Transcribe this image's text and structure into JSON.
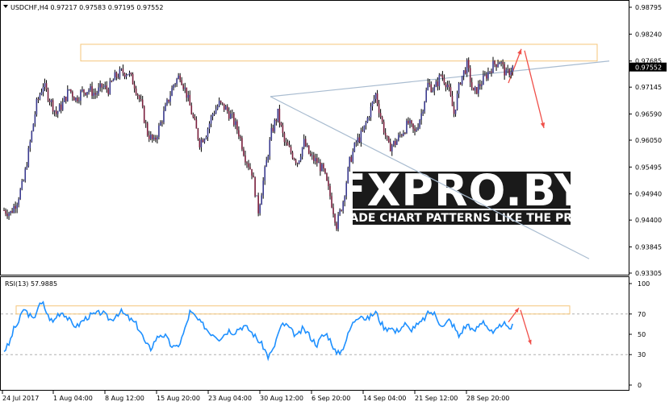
{
  "chart_data": [
    {
      "type": "candlestick",
      "symbol_timeframe": "USDCHF,H4",
      "ohlc_header": "0.97217 0.97583 0.97195 0.97552",
      "current_price_label": "0.97552",
      "y_ticks": [
        "0.98795",
        "0.98240",
        "0.97685",
        "0.97145",
        "0.96590",
        "0.96050",
        "0.95495",
        "0.94940",
        "0.94400",
        "0.93845",
        "0.93305"
      ],
      "ylim": [
        0.93305,
        0.98795
      ],
      "x_ticks": [
        "24 Jul 2017",
        "1 Aug 04:00",
        "8 Aug 12:00",
        "15 Aug 20:00",
        "23 Aug 04:00",
        "30 Aug 12:00",
        "6 Sep 20:00",
        "14 Sep 04:00",
        "21 Sep 12:00",
        "28 Sep 20:00"
      ],
      "close_anchors": [
        [
          0,
          0.946
        ],
        [
          4,
          0.9455
        ],
        [
          8,
          0.948
        ],
        [
          12,
          0.952
        ],
        [
          16,
          0.96
        ],
        [
          20,
          0.968
        ],
        [
          24,
          0.972
        ],
        [
          28,
          0.969
        ],
        [
          32,
          0.966
        ],
        [
          36,
          0.968
        ],
        [
          40,
          0.971
        ],
        [
          44,
          0.969
        ],
        [
          48,
          0.9705
        ],
        [
          52,
          0.971
        ],
        [
          56,
          0.97
        ],
        [
          60,
          0.9715
        ],
        [
          64,
          0.971
        ],
        [
          68,
          0.9735
        ],
        [
          72,
          0.9745
        ],
        [
          76,
          0.9745
        ],
        [
          80,
          0.972
        ],
        [
          84,
          0.968
        ],
        [
          88,
          0.962
        ],
        [
          92,
          0.96
        ],
        [
          96,
          0.964
        ],
        [
          100,
          0.968
        ],
        [
          104,
          0.972
        ],
        [
          108,
          0.974
        ],
        [
          112,
          0.97
        ],
        [
          116,
          0.965
        ],
        [
          120,
          0.96
        ],
        [
          124,
          0.962
        ],
        [
          128,
          0.966
        ],
        [
          132,
          0.968
        ],
        [
          136,
          0.967
        ],
        [
          140,
          0.965
        ],
        [
          144,
          0.962
        ],
        [
          148,
          0.957
        ],
        [
          152,
          0.954
        ],
        [
          156,
          0.946
        ],
        [
          160,
          0.954
        ],
        [
          164,
          0.962
        ],
        [
          168,
          0.966
        ],
        [
          172,
          0.96
        ],
        [
          176,
          0.958
        ],
        [
          180,
          0.956
        ],
        [
          184,
          0.96
        ],
        [
          188,
          0.957
        ],
        [
          192,
          0.956
        ],
        [
          196,
          0.954
        ],
        [
          200,
          0.949
        ],
        [
          204,
          0.943
        ],
        [
          208,
          0.948
        ],
        [
          212,
          0.956
        ],
        [
          216,
          0.96
        ],
        [
          220,
          0.962
        ],
        [
          224,
          0.966
        ],
        [
          228,
          0.97
        ],
        [
          232,
          0.964
        ],
        [
          236,
          0.959
        ],
        [
          240,
          0.96
        ],
        [
          244,
          0.962
        ],
        [
          248,
          0.964
        ],
        [
          252,
          0.962
        ],
        [
          256,
          0.966
        ],
        [
          260,
          0.972
        ],
        [
          264,
          0.971
        ],
        [
          268,
          0.974
        ],
        [
          272,
          0.972
        ],
        [
          276,
          0.966
        ],
        [
          280,
          0.973
        ],
        [
          284,
          0.976
        ],
        [
          288,
          0.97
        ],
        [
          292,
          0.972
        ],
        [
          296,
          0.974
        ],
        [
          300,
          0.976
        ],
        [
          304,
          0.977
        ],
        [
          308,
          0.974
        ],
        [
          312,
          0.9755
        ]
      ],
      "overlays": {
        "resistance_zone": [
          0.97685,
          0.9803
        ],
        "rising_trendline": [
          [
            0.9695
          ],
          [
            0.97685
          ]
        ],
        "falling_trendline": [
          [
            0.9695
          ],
          [
            0.936
          ]
        ],
        "projected_move": [
          0.98,
          0.963
        ]
      },
      "watermark": {
        "brand": "FXPRO.BY",
        "tagline": "TRADE CHART PATTERNS LIKE THE PROS"
      }
    },
    {
      "type": "line",
      "indicator": "RSI(13) 57.9885",
      "ylim": [
        0,
        100
      ],
      "y_ticks": [
        "100",
        "70",
        "50",
        "30",
        "0"
      ],
      "levels": [
        70,
        30
      ],
      "zone": [
        70,
        78
      ],
      "values": [
        [
          0,
          34
        ],
        [
          3,
          40
        ],
        [
          6,
          55
        ],
        [
          9,
          62
        ],
        [
          12,
          75
        ],
        [
          15,
          70
        ],
        [
          18,
          64
        ],
        [
          21,
          78
        ],
        [
          24,
          80
        ],
        [
          27,
          68
        ],
        [
          30,
          62
        ],
        [
          33,
          70
        ],
        [
          36,
          72
        ],
        [
          39,
          66
        ],
        [
          42,
          60
        ],
        [
          45,
          58
        ],
        [
          48,
          63
        ],
        [
          51,
          67
        ],
        [
          54,
          69
        ],
        [
          57,
          70
        ],
        [
          60,
          72
        ],
        [
          63,
          67
        ],
        [
          66,
          64
        ],
        [
          69,
          70
        ],
        [
          72,
          72
        ],
        [
          75,
          68
        ],
        [
          78,
          64
        ],
        [
          81,
          60
        ],
        [
          84,
          52
        ],
        [
          87,
          40
        ],
        [
          90,
          36
        ],
        [
          93,
          45
        ],
        [
          96,
          50
        ],
        [
          99,
          48
        ],
        [
          102,
          40
        ],
        [
          105,
          36
        ],
        [
          108,
          42
        ],
        [
          111,
          55
        ],
        [
          114,
          72
        ],
        [
          117,
          68
        ],
        [
          120,
          62
        ],
        [
          123,
          58
        ],
        [
          126,
          52
        ],
        [
          129,
          50
        ],
        [
          132,
          46
        ],
        [
          135,
          50
        ],
        [
          138,
          54
        ],
        [
          141,
          52
        ],
        [
          144,
          56
        ],
        [
          147,
          58
        ],
        [
          150,
          55
        ],
        [
          153,
          50
        ],
        [
          156,
          44
        ],
        [
          159,
          38
        ],
        [
          162,
          28
        ],
        [
          165,
          34
        ],
        [
          168,
          50
        ],
        [
          171,
          60
        ],
        [
          174,
          58
        ],
        [
          177,
          52
        ],
        [
          180,
          48
        ],
        [
          183,
          55
        ],
        [
          186,
          52
        ],
        [
          189,
          45
        ],
        [
          192,
          40
        ],
        [
          195,
          48
        ],
        [
          198,
          50
        ],
        [
          201,
          42
        ],
        [
          204,
          30
        ],
        [
          207,
          34
        ],
        [
          210,
          45
        ],
        [
          213,
          58
        ],
        [
          216,
          66
        ],
        [
          219,
          70
        ],
        [
          222,
          64
        ],
        [
          225,
          68
        ],
        [
          228,
          72
        ],
        [
          231,
          62
        ],
        [
          234,
          55
        ],
        [
          237,
          58
        ],
        [
          240,
          52
        ],
        [
          243,
          56
        ],
        [
          246,
          60
        ],
        [
          249,
          54
        ],
        [
          252,
          58
        ],
        [
          255,
          60
        ],
        [
          258,
          66
        ],
        [
          261,
          72
        ],
        [
          264,
          70
        ],
        [
          267,
          62
        ],
        [
          270,
          58
        ],
        [
          273,
          64
        ],
        [
          276,
          58
        ],
        [
          279,
          48
        ],
        [
          282,
          56
        ],
        [
          285,
          60
        ],
        [
          288,
          52
        ],
        [
          291,
          58
        ],
        [
          294,
          64
        ],
        [
          297,
          56
        ],
        [
          300,
          50
        ],
        [
          303,
          55
        ],
        [
          306,
          62
        ],
        [
          309,
          55
        ],
        [
          312,
          58
        ]
      ]
    }
  ]
}
